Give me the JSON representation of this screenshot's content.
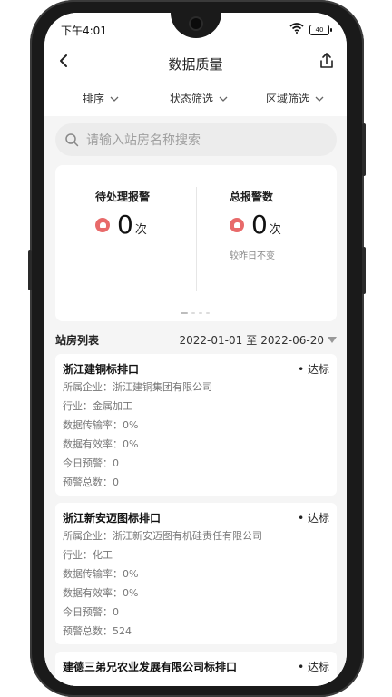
{
  "status_bar": {
    "time": "下午4:01",
    "battery": "40"
  },
  "header": {
    "title": "数据质量"
  },
  "filters": [
    {
      "label": "排序"
    },
    {
      "label": "状态筛选"
    },
    {
      "label": "区域筛选"
    }
  ],
  "search": {
    "placeholder": "请输入站房名称搜索"
  },
  "stats": {
    "pending": {
      "label": "待处理报警",
      "value": "0",
      "unit": "次"
    },
    "total": {
      "label": "总报警数",
      "value": "0",
      "unit": "次",
      "note": "较昨日不变"
    }
  },
  "list": {
    "title": "站房列表",
    "date_from": "2022-01-01",
    "date_sep": "至",
    "date_to": "2022-06-20"
  },
  "cards": [
    {
      "name": "浙江建铜标排口",
      "status": "• 达标",
      "company": "所属企业：浙江建铜集团有限公司",
      "industry": "行业：金属加工",
      "transfer": "数据传输率：0%",
      "valid": "数据有效率：0%",
      "today": "今日预警：0",
      "total": "预警总数：0"
    },
    {
      "name": "浙江新安迈图标排口",
      "status": "• 达标",
      "company": "所属企业：浙江新安迈图有机硅责任有限公司",
      "industry": "行业：化工",
      "transfer": "数据传输率：0%",
      "valid": "数据有效率：0%",
      "today": "今日预警：0",
      "total": "预警总数：524"
    },
    {
      "name": "建德三弟兄农业发展有限公司标排口",
      "status": "• 达标"
    }
  ],
  "colors": {
    "alarm": "#e86a6a",
    "background": "#f5f5f5"
  }
}
